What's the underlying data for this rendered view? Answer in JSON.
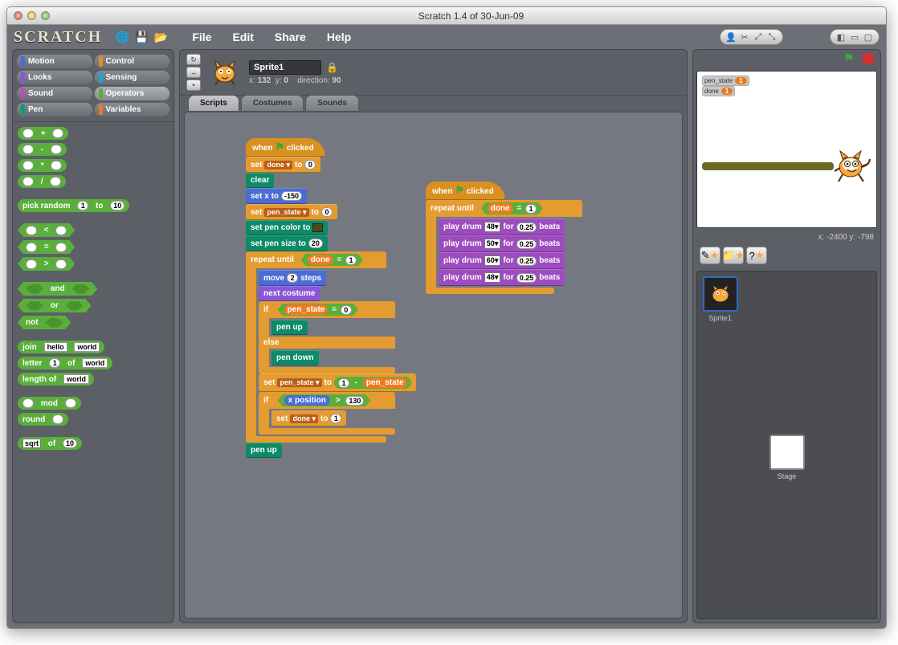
{
  "window": {
    "title": "Scratch 1.4 of 30-Jun-09"
  },
  "menu": {
    "file": "File",
    "edit": "Edit",
    "share": "Share",
    "help": "Help"
  },
  "logo": "SCRATCH",
  "categories": [
    {
      "name": "Motion",
      "color": "#4a6cd4"
    },
    {
      "name": "Control",
      "color": "#d89020"
    },
    {
      "name": "Looks",
      "color": "#8a55d7"
    },
    {
      "name": "Sensing",
      "color": "#1ba2d6"
    },
    {
      "name": "Sound",
      "color": "#bd4cc1"
    },
    {
      "name": "Operators",
      "color": "#5aaf3b",
      "sel": true
    },
    {
      "name": "Pen",
      "color": "#0e9a7c"
    },
    {
      "name": "Variables",
      "color": "#e87c1f"
    }
  ],
  "palette": {
    "plus": "+",
    "minus": "-",
    "times": "*",
    "div": "/",
    "pick_random": "pick random",
    "to": "to",
    "pr1": "1",
    "pr10": "10",
    "lt": "<",
    "eq": "=",
    "gt": ">",
    "and": "and",
    "or": "or",
    "not": "not",
    "join": "join",
    "join_a": "hello",
    "join_b": "world",
    "letter": "letter",
    "letter_n": "1",
    "of": "of",
    "letter_s": "world",
    "length": "length of",
    "length_s": "world",
    "mod": "mod",
    "round": "round",
    "sqrt": "sqrt",
    "sqrt_of": "of",
    "sqrt_n": "10"
  },
  "sprite": {
    "name": "Sprite1",
    "x_label": "x:",
    "x": "132",
    "y_label": "y:",
    "y": "0",
    "dir_label": "direction:",
    "dir": "90"
  },
  "tabs": {
    "scripts": "Scripts",
    "costumes": "Costumes",
    "sounds": "Sounds"
  },
  "script1": {
    "when_clicked": "clicked",
    "when": "when",
    "set": "set",
    "to": "to",
    "done": "done",
    "zero": "0",
    "one": "1",
    "clear": "clear",
    "setx": "set x to",
    "setx_v": "-150",
    "pen_state": "pen_state",
    "pencolor": "set pen color to",
    "pensize": "set pen size to",
    "pensize_v": "20",
    "repeat": "repeat until",
    "move": "move",
    "move_v": "2",
    "steps": "steps",
    "nextc": "next costume",
    "if": "if",
    "else": "else",
    "penup": "pen up",
    "pendown": "pen down",
    "xpos": "x position",
    "gt": ">",
    "xlim": "130",
    "minus": "-"
  },
  "script2": {
    "when": "when",
    "clicked": "clicked",
    "repeat": "repeat until",
    "done": "done",
    "one": "1",
    "play": "play drum",
    "for": "for",
    "beats": "beats",
    "dur": "0.25",
    "d1": "48",
    "d2": "50",
    "d3": "60",
    "d4": "48"
  },
  "stage": {
    "watch1_label": "pen_state",
    "watch1_val": "1",
    "watch2_label": "done",
    "watch2_val": "1",
    "coords": "x: -2400 y: -798",
    "label_stage": "Stage",
    "label_sprite": "Sprite1"
  }
}
